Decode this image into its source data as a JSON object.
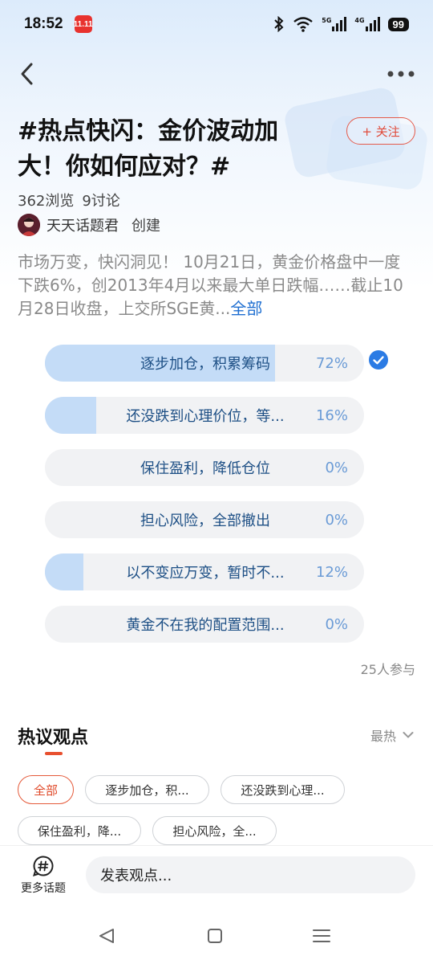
{
  "status_bar": {
    "time": "18:52",
    "app_badge": "11.11",
    "network_5g": "5G",
    "network_4g": "4G",
    "battery": "99"
  },
  "topic": {
    "title": "#热点快闪：金价波动加大！你如何应对？#",
    "follow_label": "+ 关注",
    "views": "362浏览",
    "discussions": "9讨论",
    "creator_name": "天天话题君",
    "creator_role": "创建",
    "description": "市场万变，快闪洞见！ 10月21日，黄金价格盘中一度下跌6%，创2013年4月以来最大单日跌幅……截止10月28日收盘，上交所SGE黄...",
    "description_more": "全部"
  },
  "poll": {
    "options": [
      {
        "label": "逐步加仓，积累筹码",
        "percent_text": "72%",
        "percent": 72,
        "selected": true
      },
      {
        "label": "还没跌到心理价位，等...",
        "percent_text": "16%",
        "percent": 16,
        "selected": false
      },
      {
        "label": "保住盈利，降低仓位",
        "percent_text": "0%",
        "percent": 0,
        "selected": false
      },
      {
        "label": "担心风险，全部撤出",
        "percent_text": "0%",
        "percent": 0,
        "selected": false
      },
      {
        "label": "以不变应万变，暂时不...",
        "percent_text": "12%",
        "percent": 12,
        "selected": false
      },
      {
        "label": "黄金不在我的配置范围...",
        "percent_text": "0%",
        "percent": 0,
        "selected": false
      }
    ],
    "participants": "25人参与"
  },
  "hot_views": {
    "title": "热议观点",
    "sort_label": "最热",
    "chips": [
      "全部",
      "逐步加仓，积...",
      "还没跌到心理...",
      "保住盈利，降...",
      "担心风险，全..."
    ]
  },
  "bottom_bar": {
    "more_topics_label": "更多话题",
    "input_placeholder": "发表观点..."
  },
  "colors": {
    "accent_red": "#e55a3a",
    "poll_fill": "#c4dcf7",
    "poll_text": "#1d4f85",
    "check_blue": "#2b7be4"
  }
}
